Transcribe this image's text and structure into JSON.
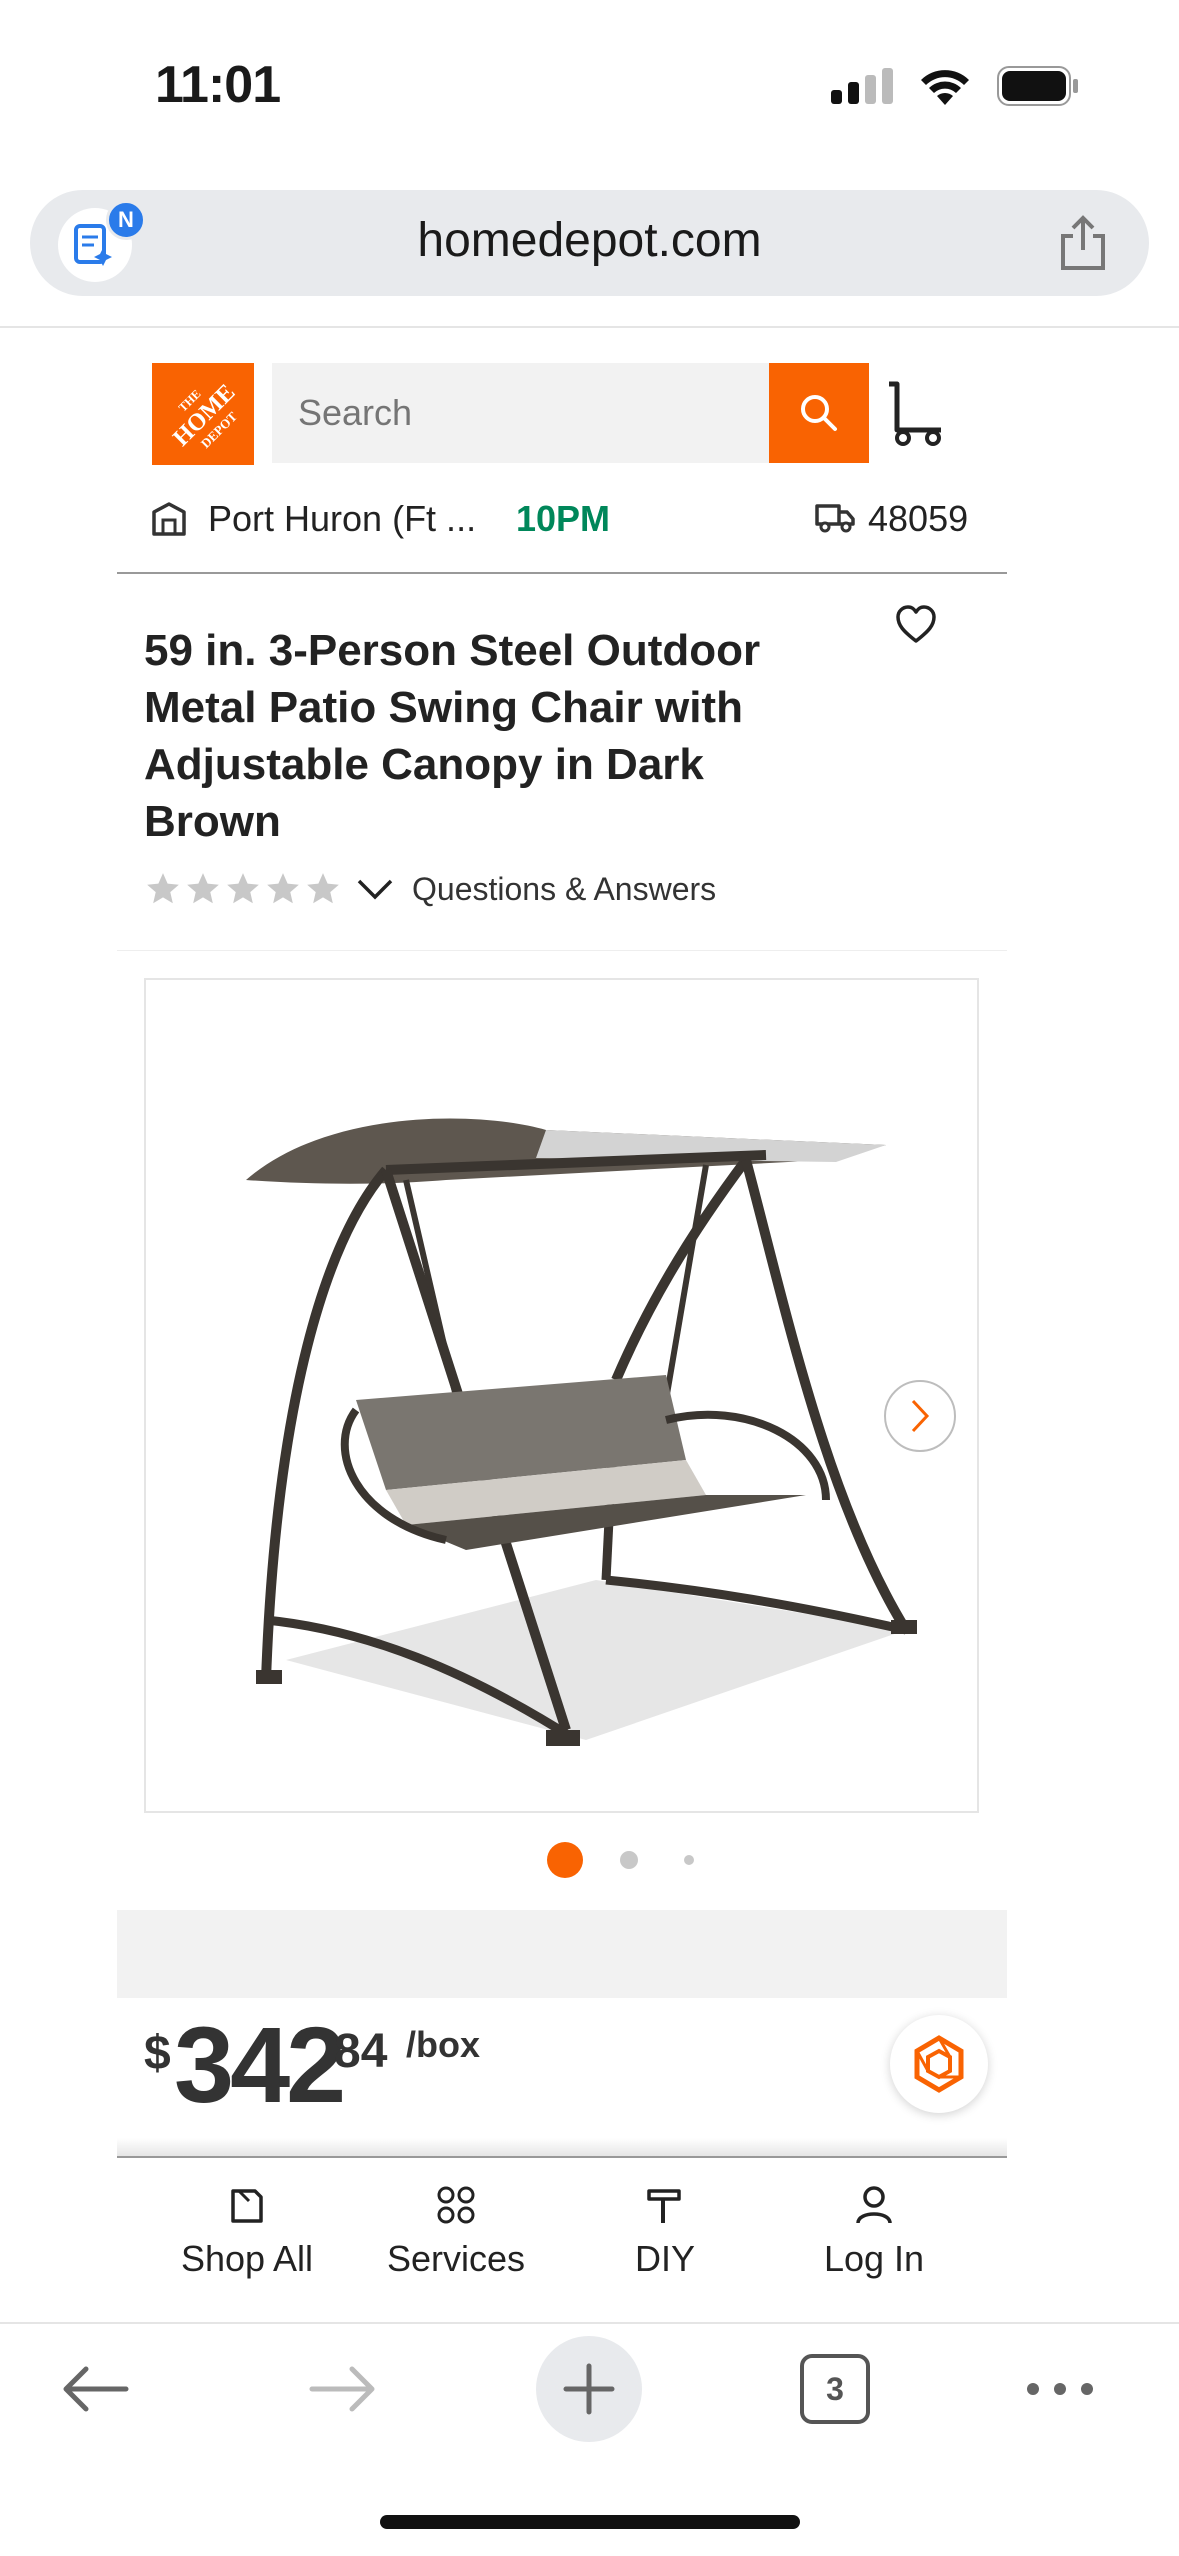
{
  "status_bar": {
    "time": "11:01"
  },
  "browser": {
    "url": "homedepot.com",
    "assistant_badge": "N",
    "tabs_count": "3"
  },
  "header": {
    "logo_text": "THE HOME DEPOT",
    "search_placeholder": "Search",
    "store_name": "Port Huron (Ft ...",
    "store_hours": "10PM",
    "zip_code": "48059"
  },
  "product": {
    "title": "59 in. 3-Person Steel Outdoor Metal Patio Swing Chair with Adjustable Canopy in Dark Brown",
    "rating": 0,
    "rating_max": 5,
    "qa_link": "Questions & Answers",
    "carousel": {
      "current": 1,
      "total": 3
    },
    "price": {
      "currency": "$",
      "dollars": "342",
      "cents": "84",
      "unit": "/box"
    }
  },
  "site_nav": [
    {
      "label": "Shop All",
      "icon": "shop-all-icon"
    },
    {
      "label": "Services",
      "icon": "services-icon"
    },
    {
      "label": "DIY",
      "icon": "diy-icon"
    },
    {
      "label": "Log In",
      "icon": "user-icon"
    }
  ],
  "colors": {
    "brand_orange": "#f96302",
    "hours_green": "#00875a"
  }
}
